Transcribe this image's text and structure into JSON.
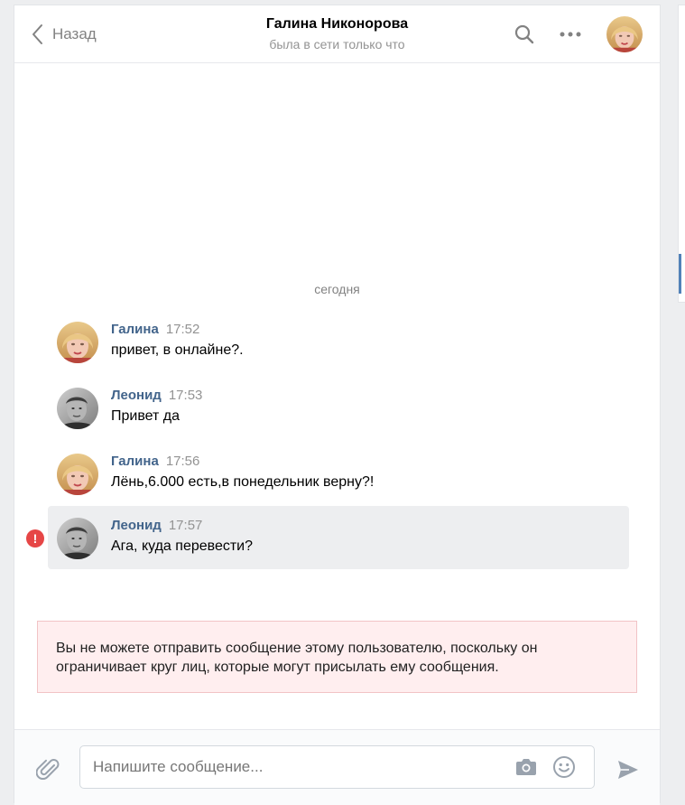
{
  "header": {
    "back_label": "Назад",
    "title": "Галина Никонорова",
    "subtitle": "была в сети только что"
  },
  "chat": {
    "day_label": "сегодня",
    "messages": [
      {
        "author": "Галина",
        "time": "17:52",
        "text": "привет, в онлайне?."
      },
      {
        "author": "Леонид",
        "time": "17:53",
        "text": "Привет да"
      },
      {
        "author": "Галина",
        "time": "17:56",
        "text": "Лёнь,6.000 есть,в понедельник верну?!"
      },
      {
        "author": "Леонид",
        "time": "17:57",
        "text": "Ага, куда перевести?",
        "error_mark": "!"
      }
    ]
  },
  "notice": {
    "text": "Вы не можете отправить сообщение этому пользователю, поскольку он ограничивает круг лиц, которые могут присылать ему сообщения."
  },
  "composer": {
    "placeholder": "Напишите сообщение..."
  },
  "colors": {
    "author_link": "#42648b",
    "error_red": "#e64646",
    "notice_bg": "#ffeeef",
    "highlight_bg": "#edeef0"
  }
}
